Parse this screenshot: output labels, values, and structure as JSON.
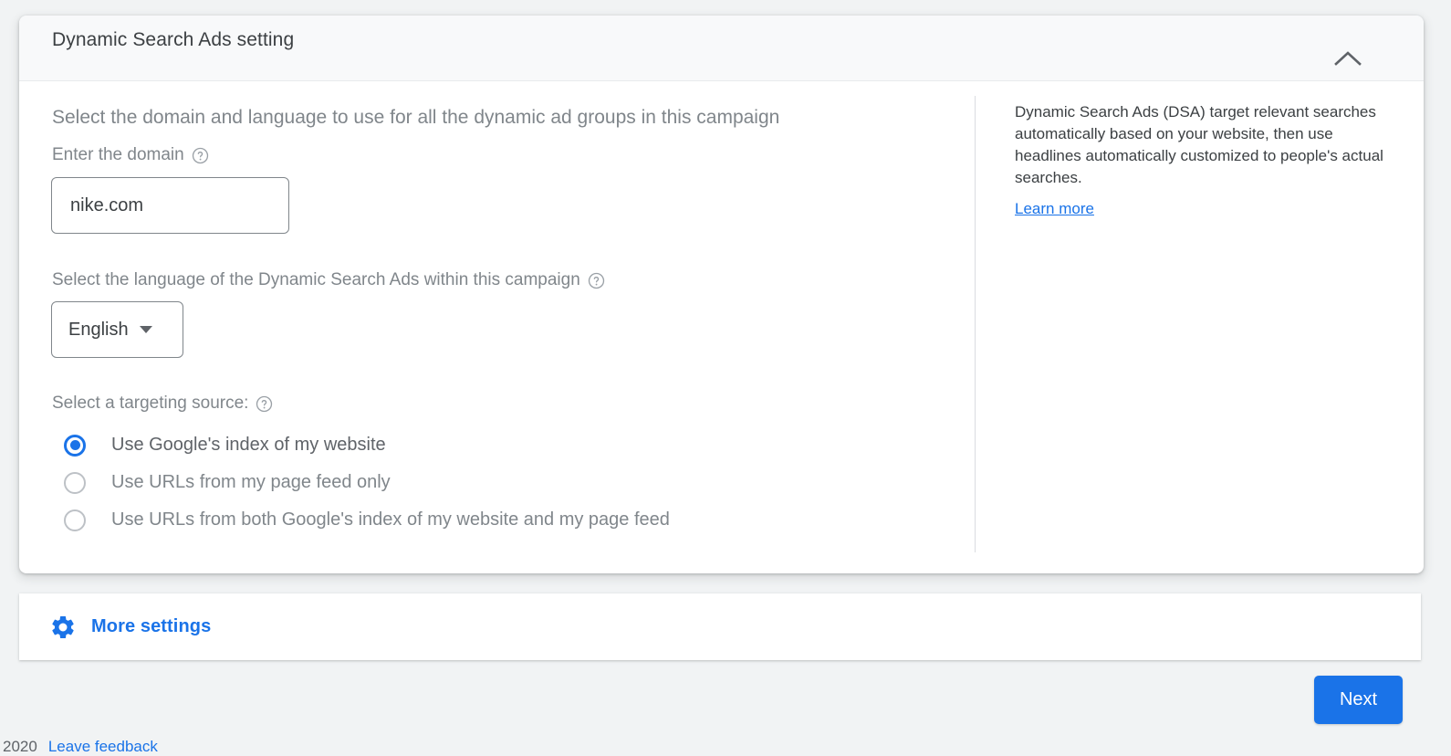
{
  "card": {
    "title": "Dynamic Search Ads setting",
    "collapse_icon": "chevron-up-icon"
  },
  "form": {
    "lead_text": "Select the domain and language to use for all the dynamic ad groups in this campaign",
    "domain_label": "Enter the domain",
    "domain_value": "nike.com",
    "domain_placeholder": "",
    "language_label": "Select the language of the Dynamic Search Ads within this campaign",
    "language_value": "English",
    "targeting_label": "Select a targeting source:",
    "help_icon": "help-circle-icon",
    "targeting_options": [
      {
        "label": "Use Google's index of my website",
        "selected": true
      },
      {
        "label": "Use URLs from my page feed only",
        "selected": false
      },
      {
        "label": "Use URLs from both Google's index of my website and my page feed",
        "selected": false
      }
    ]
  },
  "info_panel": {
    "description": "Dynamic Search Ads (DSA) target relevant searches automatically based on your website, then use headlines automatically customized to people's actual searches.",
    "learn_more": "Learn more"
  },
  "more_settings": {
    "label": "More settings",
    "icon": "gear-icon"
  },
  "footer": {
    "next_label": "Next",
    "year": "2020",
    "feedback_label": "Leave feedback"
  },
  "colors": {
    "accent": "#1a73e8",
    "page_bg": "#f1f3f4",
    "header_bg": "#f8f9fa",
    "text_muted": "#80868b"
  }
}
